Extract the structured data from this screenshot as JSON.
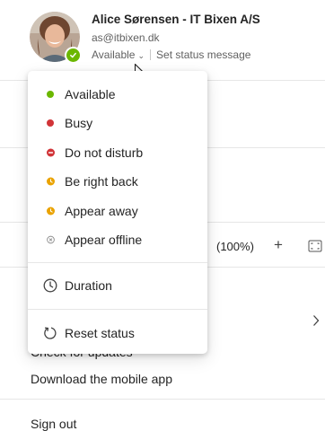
{
  "profile": {
    "name": "Alice Sørensen - IT Bixen A/S",
    "email": "as@itbixen.dk",
    "status_label": "Available",
    "set_status_message": "Set status message"
  },
  "status_menu": {
    "items": [
      {
        "label": "Available",
        "icon": "available-dot-icon",
        "color": "#6bb700"
      },
      {
        "label": "Busy",
        "icon": "busy-dot-icon",
        "color": "#d13438"
      },
      {
        "label": "Do not disturb",
        "icon": "do-not-disturb-icon",
        "color": "#d13438"
      },
      {
        "label": "Be right back",
        "icon": "clock-dot-icon",
        "color": "#eaa300"
      },
      {
        "label": "Appear away",
        "icon": "clock-dot-icon",
        "color": "#eaa300"
      },
      {
        "label": "Appear offline",
        "icon": "offline-icon",
        "color": "#8a8a8a"
      }
    ],
    "duration_label": "Duration",
    "reset_label": "Reset status"
  },
  "background_menu": {
    "zoom_value": "(100%)",
    "zoom_plus": "+",
    "check_updates": "Check for updates",
    "download_mobile": "Download the mobile app",
    "sign_out": "Sign out"
  }
}
